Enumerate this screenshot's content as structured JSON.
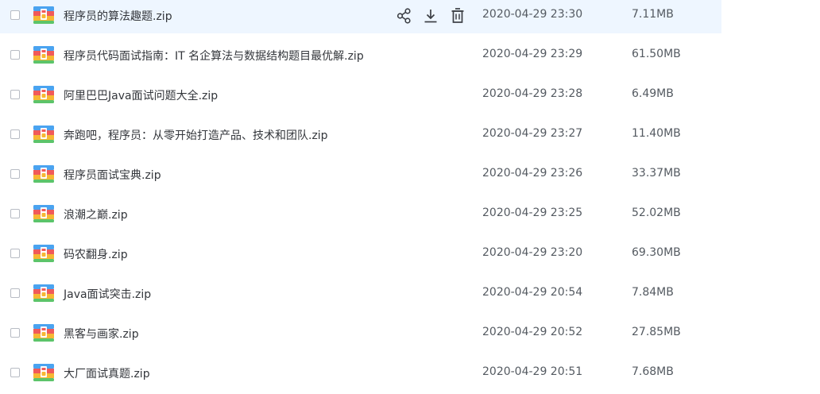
{
  "files": [
    {
      "name": "程序员的算法趣题.zip",
      "date": "2020-04-29 23:30",
      "size": "7.11MB"
    },
    {
      "name": "程序员代码面试指南：IT 名企算法与数据结构题目最优解.zip",
      "date": "2020-04-29 23:29",
      "size": "61.50MB"
    },
    {
      "name": "阿里巴巴Java面试问题大全.zip",
      "date": "2020-04-29 23:28",
      "size": "6.49MB"
    },
    {
      "name": "奔跑吧，程序员：从零开始打造产品、技术和团队.zip",
      "date": "2020-04-29 23:27",
      "size": "11.40MB"
    },
    {
      "name": "程序员面试宝典.zip",
      "date": "2020-04-29 23:26",
      "size": "33.37MB"
    },
    {
      "name": "浪潮之巅.zip",
      "date": "2020-04-29 23:25",
      "size": "52.02MB"
    },
    {
      "name": "码农翻身.zip",
      "date": "2020-04-29 23:20",
      "size": "69.30MB"
    },
    {
      "name": "Java面试突击.zip",
      "date": "2020-04-29 20:54",
      "size": "7.84MB"
    },
    {
      "name": "黑客与画家.zip",
      "date": "2020-04-29 20:52",
      "size": "27.85MB"
    },
    {
      "name": "大厂面试真题.zip",
      "date": "2020-04-29 20:51",
      "size": "7.68MB"
    }
  ],
  "hovered_row": 0,
  "row_actions": [
    "share-icon",
    "download-icon",
    "delete-icon"
  ],
  "file_icon": "zip-archive-icon",
  "colors": {
    "hover_bg": "#eef6ff",
    "icon_action": "#3b3e44"
  }
}
